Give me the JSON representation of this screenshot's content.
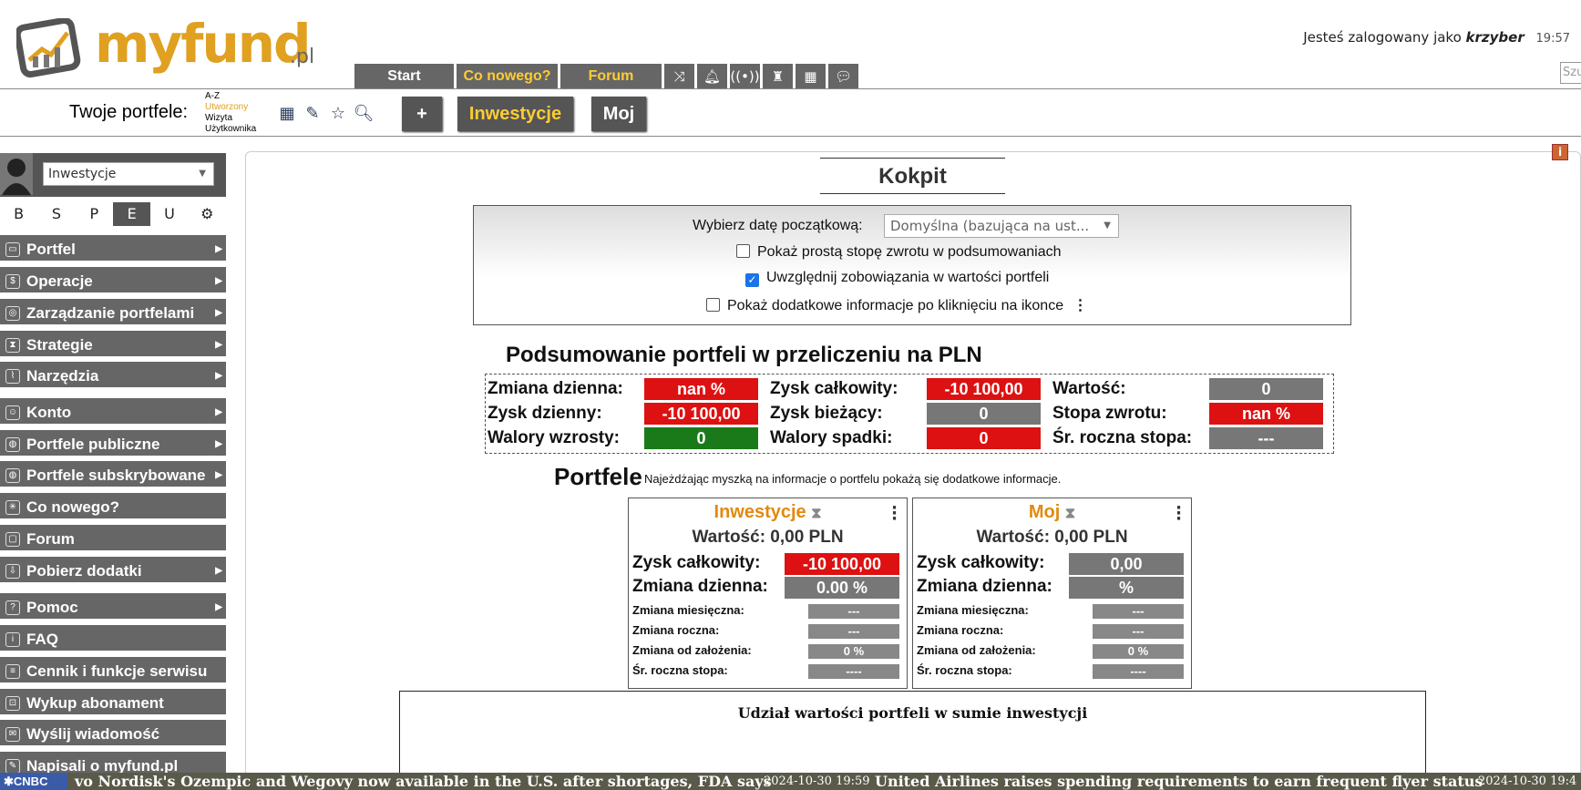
{
  "header": {
    "logo_text": "myfund",
    "logo_suffix": ".pl",
    "nav_tabs": [
      "Start",
      "Co nowego?",
      "Forum"
    ],
    "icon_tabs": [
      "shuffle-icon",
      "bell-icon",
      "broadcast-icon",
      "chess-rook-icon",
      "calendar-icon",
      "chat-icon"
    ],
    "login_prefix": "Jesteś zalogowany jako",
    "login_user": "krzyber",
    "login_time": "19:57",
    "search_placeholder": "Szu"
  },
  "portfolio_bar": {
    "title": "Twoje portfele:",
    "sort_options": [
      "A-Z",
      "Utworzony",
      "Wizyta",
      "Użytkownika"
    ],
    "active_sort": "Utworzony",
    "add_label": "+",
    "portfolios": [
      "Inwestycje",
      "Moj"
    ],
    "icons": [
      "grid-icon",
      "edit-icon",
      "star-icon",
      "search-zoom-icon"
    ]
  },
  "sidebar": {
    "portfolio_select": "Inwestycje",
    "letter_tabs": [
      "B",
      "S",
      "P",
      "E",
      "U"
    ],
    "active_letter": "E",
    "menu": [
      {
        "label": "Portfel",
        "arrow": true
      },
      {
        "label": "Operacje",
        "arrow": true
      },
      {
        "label": "Zarządzanie portfelami",
        "arrow": true
      },
      {
        "label": "Strategie",
        "arrow": true
      },
      {
        "label": "Narzędzia",
        "arrow": true
      },
      {
        "label": "Konto",
        "arrow": true
      },
      {
        "label": "Portfele publiczne",
        "arrow": true
      },
      {
        "label": "Portfele subskrybowane",
        "arrow": true
      },
      {
        "label": "Co nowego?",
        "arrow": false
      },
      {
        "label": "Forum",
        "arrow": false
      },
      {
        "label": "Pobierz dodatki",
        "arrow": true
      },
      {
        "label": "Pomoc",
        "arrow": true
      },
      {
        "label": "FAQ",
        "arrow": false
      },
      {
        "label": "Cennik i funkcje serwisu",
        "arrow": false
      },
      {
        "label": "Wykup abonament",
        "arrow": false
      },
      {
        "label": "Wyślij wiadomość",
        "arrow": false
      },
      {
        "label": "Napisali o myfund.pl",
        "arrow": false
      }
    ]
  },
  "main": {
    "title": "Kokpit",
    "options": {
      "date_label": "Wybierz datę początkową:",
      "date_value": "Domyślna (bazująca na ust...",
      "opt1": "Pokaż prostą stopę zwrotu w podsumowaniach",
      "opt1_checked": false,
      "opt2": "Uwzględnij zobowiązania w wartości portfeli",
      "opt2_checked": true,
      "opt3": "Pokaż dodatkowe informacje po kliknięciu na ikonce",
      "opt3_checked": false
    },
    "summary": {
      "title": "Podsumowanie portfeli w przeliczeniu na PLN",
      "zmiana_dzienna_label": "Zmiana dzienna:",
      "zmiana_dzienna": "nan %",
      "zysk_dzienny_label": "Zysk dzienny:",
      "zysk_dzienny": "-10 100,00",
      "walory_wzrosty_label": "Walory wzrosty:",
      "walory_wzrosty": "0",
      "zysk_calkowity_label": "Zysk całkowity:",
      "zysk_calkowity": "-10 100,00",
      "zysk_biezacy_label": "Zysk bieżący:",
      "zysk_biezacy": "0",
      "walory_spadki_label": "Walory spadki:",
      "walory_spadki": "0",
      "wartosc_label": "Wartość:",
      "wartosc": "0",
      "stopa_zwrotu_label": "Stopa zwrotu:",
      "stopa_zwrotu": "nan %",
      "sr_roczna_label": "Śr. roczna stopa:",
      "sr_roczna": "---"
    },
    "portfele_title": "Portfele",
    "portfele_note": "Najeżdżając myszką na informacje o portfelu pokażą się dodatkowe informacje.",
    "cards": [
      {
        "name": "Inwestycje",
        "value": "Wartość: 0,00 PLN",
        "zysk_label": "Zysk całkowity:",
        "zysk": "-10 100,00",
        "zmiana_label": "Zmiana dzienna:",
        "zmiana": "0.00 %",
        "miesieczna_label": "Zmiana miesięczna:",
        "miesieczna": "---",
        "roczna_label": "Zmiana roczna:",
        "roczna": "---",
        "od_zalozenia_label": "Zmiana od założenia:",
        "od_zalozenia": "0 %",
        "sr_label": "Śr. roczna stopa:",
        "sr": "----"
      },
      {
        "name": "Moj",
        "value": "Wartość: 0,00 PLN",
        "zysk_label": "Zysk całkowity:",
        "zysk": "0,00",
        "zmiana_label": "Zmiana dzienna:",
        "zmiana": "%",
        "miesieczna_label": "Zmiana miesięczna:",
        "miesieczna": "---",
        "roczna_label": "Zmiana roczna:",
        "roczna": "---",
        "od_zalozenia_label": "Zmiana od założenia:",
        "od_zalozenia": "0 %",
        "sr_label": "Śr. roczna stopa:",
        "sr": "----"
      }
    ],
    "share_title": "Udział wartości portfeli w sumie inwestycji"
  },
  "ticker": {
    "source": "CNBC",
    "item1": "vo Nordisk's Ozempic and Wegovy now available in the U.S. after shortages, FDA says",
    "date2": "2024-10-30 19:59",
    "item2": "United Airlines raises spending requirements to earn frequent flyer status",
    "date3": "2024-10-30 19:4"
  },
  "colors": {
    "accent": "#e0a020",
    "menu_bg": "#666666",
    "red": "#dd1111",
    "green": "#1a7a1a",
    "grey": "#777777"
  }
}
